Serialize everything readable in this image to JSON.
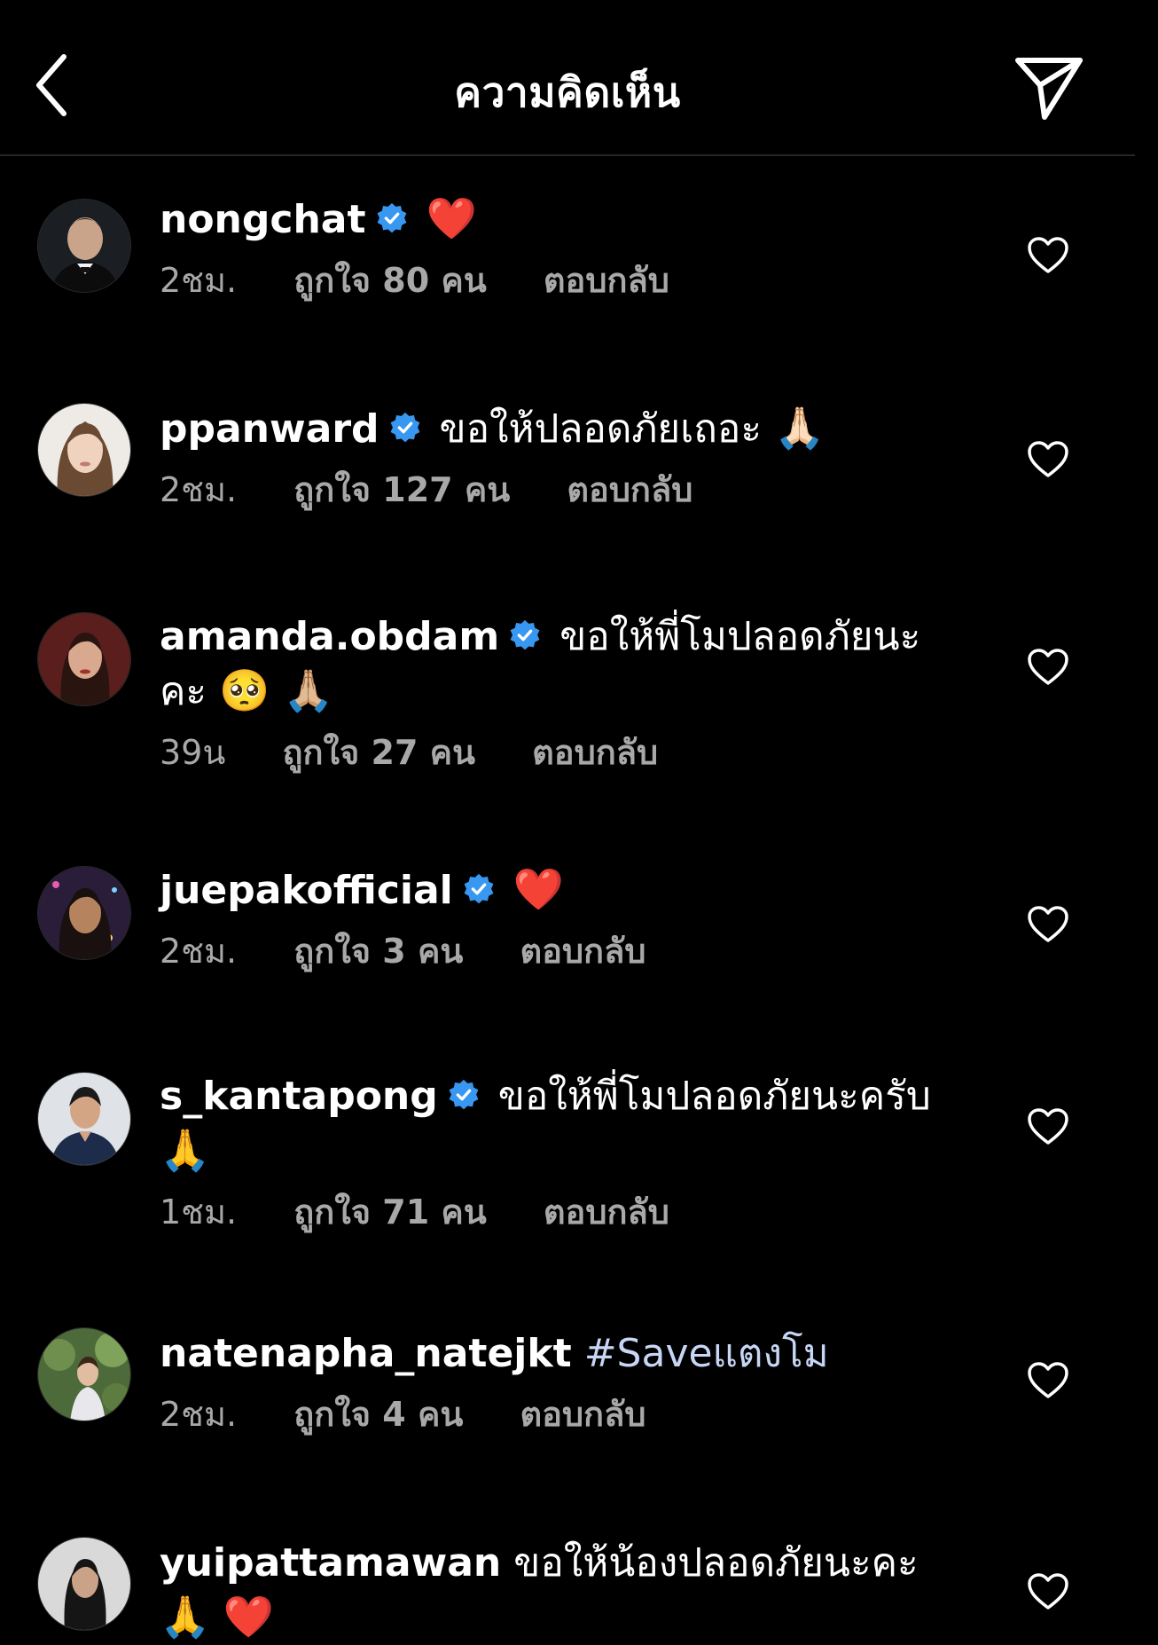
{
  "header": {
    "title": "ความคิดเห็น"
  },
  "comments": [
    {
      "username": "nongchat",
      "verified": true,
      "text": "",
      "emoji": "❤️",
      "time": "2ชม.",
      "likes": "ถูกใจ 80 คน",
      "reply": "ตอบกลับ"
    },
    {
      "username": "ppanward",
      "verified": true,
      "text": "ขอให้ปลอดภัยเถอะ",
      "emoji": "🙏🏻",
      "time": "2ชม.",
      "likes": "ถูกใจ 127 คน",
      "reply": "ตอบกลับ"
    },
    {
      "username": "amanda.obdam",
      "verified": true,
      "text": "ขอให้พี่โมปลอดภัยนะคะ",
      "emoji": "🥺 🙏🏼",
      "time": "39น",
      "likes": "ถูกใจ 27 คน",
      "reply": "ตอบกลับ"
    },
    {
      "username": "juepakofficial",
      "verified": true,
      "text": "",
      "emoji": "❤️",
      "time": "2ชม.",
      "likes": "ถูกใจ 3 คน",
      "reply": "ตอบกลับ"
    },
    {
      "username": "s_kantapong",
      "verified": true,
      "text": "ขอให้พี่โมปลอดภัยนะครับ",
      "emoji": "🙏",
      "time": "1ชม.",
      "likes": "ถูกใจ 71 คน",
      "reply": "ตอบกลับ"
    },
    {
      "username": "natenapha_natejkt",
      "verified": false,
      "text": "#Saveแตงโม",
      "emoji": "",
      "time": "2ชม.",
      "likes": "ถูกใจ 4 คน",
      "reply": "ตอบกลับ"
    },
    {
      "username": "yuipattamawan",
      "verified": false,
      "text": "ขอให้น้องปลอดภัยนะคะ",
      "emoji": "🙏 ❤️",
      "time": "",
      "likes": "",
      "reply": ""
    }
  ],
  "colors": {
    "background": "#000000",
    "text": "#ffffff",
    "meta": "#a8a8a8",
    "verified": "#3897f0",
    "hashtag": "#c7d6f5",
    "divider": "#262626"
  },
  "icons": {
    "back": "chevron-left-icon",
    "share": "paper-plane-icon",
    "verified": "verified-badge-icon",
    "like": "heart-outline-icon"
  }
}
